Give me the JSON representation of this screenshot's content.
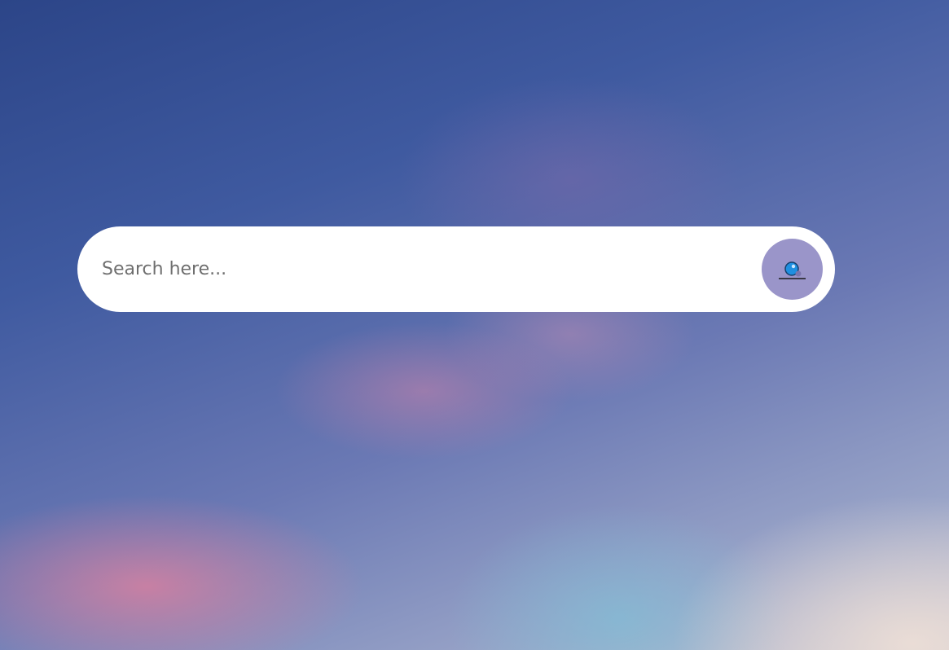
{
  "search": {
    "placeholder": "Search here...",
    "value": "",
    "button_icon": "search-icon"
  },
  "colors": {
    "search_button_bg": "#9a95c9",
    "icon_accent": "#1f8fe0"
  }
}
